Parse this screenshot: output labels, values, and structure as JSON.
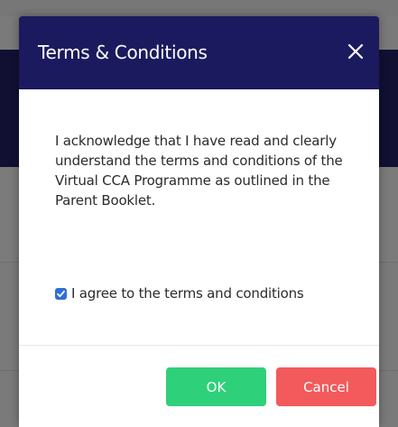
{
  "modal": {
    "title": "Terms & Conditions",
    "close_icon": "close-icon",
    "body_text": "I acknowledge that I have read and clearly understand the terms and conditions of the Virtual CCA Programme as outlined in the Parent Booklet.",
    "agree_checkbox": {
      "checked": true,
      "label": "I agree to the terms and conditions"
    },
    "ok_label": "OK",
    "cancel_label": "Cancel"
  },
  "colors": {
    "header_bg": "#1c1a5e",
    "ok_button": "#2fd07a",
    "cancel_button": "#f25a5c",
    "checkbox": "#2f6fd6"
  }
}
